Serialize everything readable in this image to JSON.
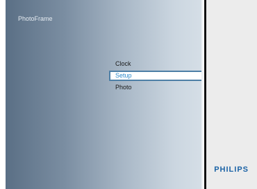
{
  "app": {
    "title": "PhotoFrame"
  },
  "menu": {
    "items": [
      {
        "label": "Clock",
        "selected": false
      },
      {
        "label": "Setup",
        "selected": true
      },
      {
        "label": "Photo",
        "selected": false
      }
    ]
  },
  "brand": {
    "name": "PHILIPS",
    "color": "#1b63a6"
  },
  "colors": {
    "selection_border": "#4d7fa6",
    "selection_text": "#2a88c9"
  }
}
